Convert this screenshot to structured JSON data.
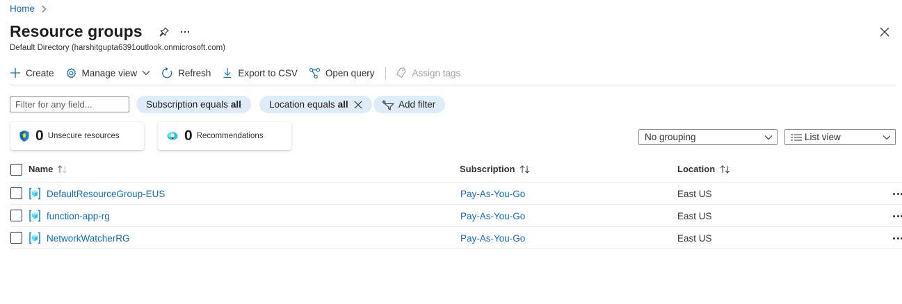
{
  "breadcrumb": {
    "home": "Home"
  },
  "header": {
    "title": "Resource groups",
    "directory": "Default Directory (harshitgupta6391outlook.onmicrosoft.com)"
  },
  "toolbar": {
    "create": "Create",
    "manage_view": "Manage view",
    "refresh": "Refresh",
    "export_csv": "Export to CSV",
    "open_query": "Open query",
    "assign_tags": "Assign tags"
  },
  "filters": {
    "search_placeholder": "Filter for any field...",
    "subscription_prefix": "Subscription equals",
    "subscription_value": "all",
    "location_prefix": "Location equals",
    "location_value": "all",
    "add_filter": "Add filter"
  },
  "cards": {
    "unsecure_count": "0",
    "unsecure_label": "Unsecure resources",
    "recommendations_count": "0",
    "recommendations_label": "Recommendations"
  },
  "view": {
    "grouping": "No grouping",
    "view_mode": "List view"
  },
  "table": {
    "columns": {
      "name": "Name",
      "subscription": "Subscription",
      "location": "Location"
    },
    "rows": [
      {
        "name": "DefaultResourceGroup-EUS",
        "subscription": "Pay-As-You-Go",
        "location": "East US"
      },
      {
        "name": "function-app-rg",
        "subscription": "Pay-As-You-Go",
        "location": "East US"
      },
      {
        "name": "NetworkWatcherRG",
        "subscription": "Pay-As-You-Go",
        "location": "East US"
      }
    ]
  },
  "colors": {
    "link": "#0f6cbd",
    "pill_bg": "#deecf9",
    "text": "#323130"
  }
}
